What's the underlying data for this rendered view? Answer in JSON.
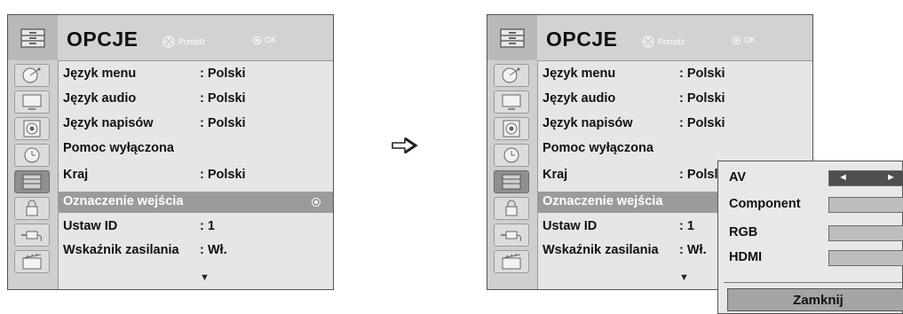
{
  "menu": {
    "title": "OPCJE",
    "nav_hint": "Przejdź",
    "ok_hint": "OK",
    "items": [
      {
        "label": "Język menu",
        "value": ": Polski"
      },
      {
        "label": "Język audio",
        "value": ": Polski"
      },
      {
        "label": "Język napisów",
        "value": ": Polski"
      },
      {
        "label": "Pomoc wyłączona",
        "value": ""
      },
      {
        "label": "Kraj",
        "value": ": Polski"
      },
      {
        "label": "Oznaczenie wejścia",
        "value": ""
      },
      {
        "label": "Ustaw ID",
        "value": ": 1"
      },
      {
        "label": "Wskaźnik zasilania",
        "value": ": Wł."
      }
    ],
    "more_indicator": "▼",
    "selected_index": 5
  },
  "right_menu_truncated": {
    "kraj_value": ": Polsl",
    "ustaw_value": ": 1",
    "wskaznik_value": ": Wł."
  },
  "popup": {
    "rows": [
      {
        "label": "AV",
        "left_arrow": "◄",
        "right_arrow": "►"
      },
      {
        "label": "Component"
      },
      {
        "label": "RGB"
      },
      {
        "label": "HDMI"
      }
    ],
    "close_label": "Zamknij"
  },
  "icons": {
    "categories": [
      "satellite-dish-icon",
      "screen-icon",
      "speaker-icon",
      "clock-icon",
      "drawer-icon",
      "lock-icon",
      "plug-icon",
      "slate-icon"
    ],
    "transition_arrow": "right-arrow-icon"
  },
  "colors": {
    "menu_bg": "#e6e6e6",
    "header_bg": "#d2d2d2",
    "selection_bar": "#9b9b9b",
    "popup_selector": "#4f4f4f"
  }
}
